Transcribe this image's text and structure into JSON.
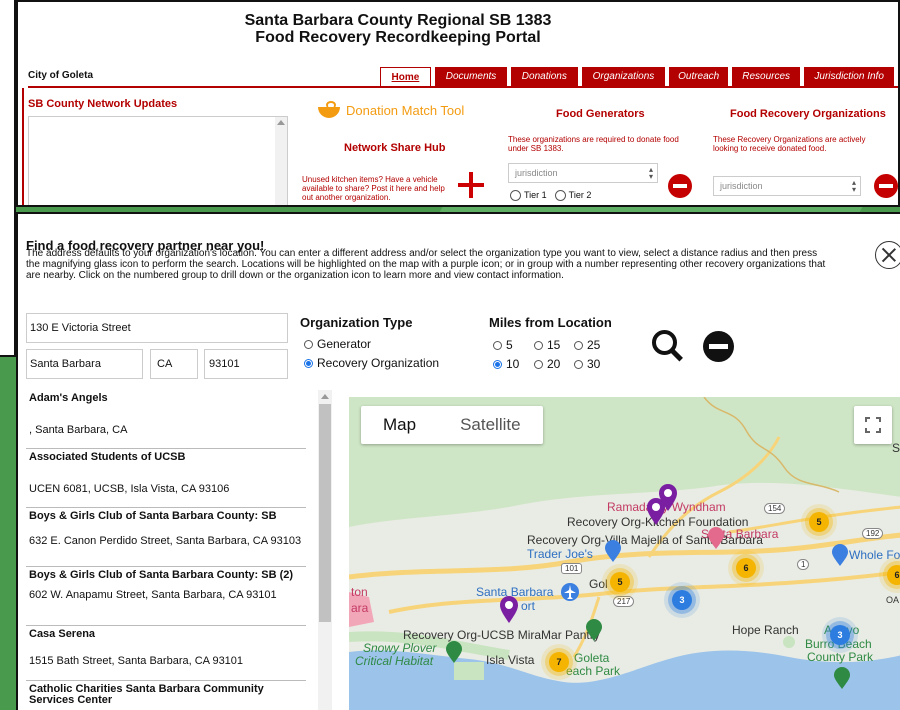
{
  "header": {
    "title_line1": "Santa Barbara County Regional SB 1383",
    "title_line2": "Food Recovery Recordkeeping Portal",
    "city": "City of Goleta"
  },
  "nav": {
    "items": [
      "Home",
      "Documents",
      "Donations",
      "Organizations",
      "Outreach",
      "Resources",
      "Jurisdiction Info"
    ]
  },
  "updates": {
    "title": "SB County Network Updates"
  },
  "donation_tool": {
    "label": "Donation Match Tool",
    "share_hub": "Network Share Hub",
    "unused_text": "Unused kitchen items? Have a vehicle available to share? Post it here and help out another organization."
  },
  "food_generators": {
    "title": "Food Generators",
    "desc": "These organizations are required to donate food under SB 1383.",
    "select_placeholder": "jurisdiction",
    "tier1": "Tier 1",
    "tier2": "Tier 2"
  },
  "food_recovery_orgs": {
    "title": "Food Recovery Organizations",
    "desc": "These Recovery Organizations are actively looking to receive donated food.",
    "select_placeholder": "jurisdiction"
  },
  "finder": {
    "heading": "Find a food recovery partner near you!",
    "instructions": "The address defaults to your organization's location.  You can enter a different address and/or select the organization type you want to view, select a distance radius and then press the magnifying glass icon to perform the search.  Locations will be highlighted on the map with a purple icon; or in group with a number representing other recovery organizations that are nearby.  Click on the numbered group to drill down or the organization icon to learn more and view contact information.",
    "street": "130 E Victoria Street",
    "city": "Santa Barbara",
    "state": "CA",
    "zip": "93101",
    "org_type_label": "Organization Type",
    "org_types": [
      {
        "label": "Generator",
        "selected": false
      },
      {
        "label": "Recovery Organization",
        "selected": true
      }
    ],
    "miles_label": "Miles from Location",
    "miles": [
      {
        "label": "5",
        "selected": false
      },
      {
        "label": "15",
        "selected": false
      },
      {
        "label": "25",
        "selected": false
      },
      {
        "label": "10",
        "selected": true
      },
      {
        "label": "20",
        "selected": false
      },
      {
        "label": "30",
        "selected": false
      }
    ]
  },
  "results": [
    {
      "name": "Adam's Angels",
      "address": ", Santa Barbara, CA"
    },
    {
      "name": "Associated Students of UCSB",
      "address": "UCEN 6081, UCSB, Isla Vista, CA 93106"
    },
    {
      "name": "Boys & Girls Club of Santa Barbara County: SB",
      "address": "632 E. Canon Perdido Street, Santa Barbara, CA 93103"
    },
    {
      "name": "Boys & Girls Club of Santa Barbara County: SB (2)",
      "address": "602 W. Anapamu Street, Santa Barbara, CA 93101"
    },
    {
      "name": "Casa Serena",
      "address": "1515 Bath Street, Santa Barbara, CA 93101"
    },
    {
      "name": "Catholic Charities Santa Barbara Community Services Center",
      "address": ""
    }
  ],
  "map": {
    "tab_map": "Map",
    "tab_satellite": "Satellite",
    "labels": {
      "ramada": "Ramada by Wyndham",
      "santa_barbara_hotel": "Santa Barbara",
      "villa_majella": "Recovery Org-Villa Majella of Santa Barbara",
      "kitchen_foundation": "Recovery Org-Kitchen Foundation",
      "trader_joes": "Trader Joe's",
      "golf": "Gol",
      "sba_airport_1": "Santa Barbara",
      "sba_airport_2": "ort",
      "ton": "ton",
      "ara": "ara",
      "miramar": "Recovery Org-UCSB MiraMar Pantry",
      "snowy_plover_1": "Snowy Plover",
      "snowy_plover_2": "Critical Habitat",
      "isla_vista": "Isla Vista",
      "goleta_beach_1": "Goleta",
      "goleta_beach_2": "each Park",
      "hope_ranch": "Hope Ranch",
      "arroyo": "Arroyo",
      "burro_beach": "Burro Beach",
      "county_park": "County Park",
      "whole_foods": "Whole Fo",
      "oa": "OA",
      "s": "S",
      "hwy154": "154",
      "hwy192": "192",
      "hwy101": "101",
      "hwy217": "217",
      "hwy1": "1"
    },
    "clusters": [
      {
        "count": "5",
        "color": "yellow"
      },
      {
        "count": "6",
        "color": "yellow"
      },
      {
        "count": "5",
        "color": "yellow"
      },
      {
        "count": "3",
        "color": "blue"
      },
      {
        "count": "3",
        "color": "blue"
      },
      {
        "count": "7",
        "color": "yellow"
      },
      {
        "count": "6",
        "color": "yellow"
      }
    ],
    "colors": {
      "land": "#e9ece4",
      "water": "#9cc3ea",
      "road": "#f7d47a",
      "green": "#c9e4c0",
      "pin": "#7b1fa2"
    }
  }
}
